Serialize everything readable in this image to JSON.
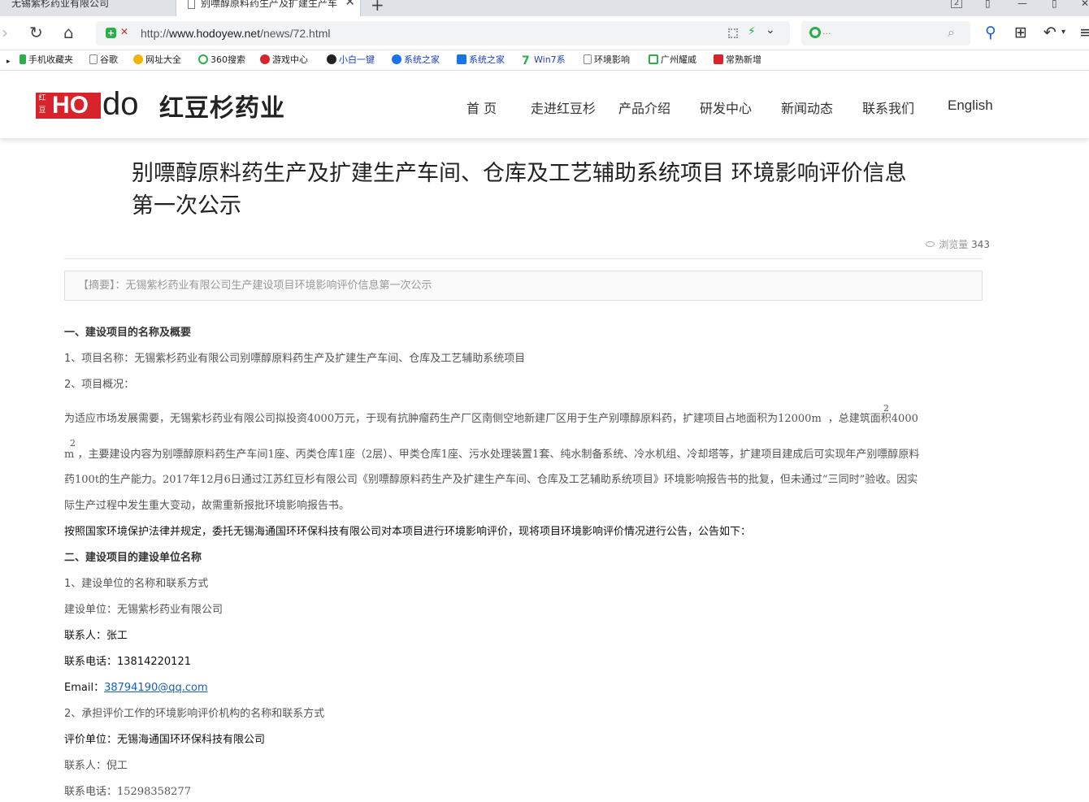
{
  "browser": {
    "tabs": [
      {
        "label": "无锡紫杉药业有限公司",
        "active": false
      },
      {
        "label": "别嘌醇原料药生产及扩建生产车",
        "active": true
      }
    ],
    "window_badge": "2",
    "url_prefix": "http://",
    "url_host": "www.hodoyew.net",
    "url_path": "/news/72.html",
    "search_hint": "...",
    "bookmarks": [
      "手机收藏夹",
      "谷歌",
      "网址大全",
      "360搜索",
      "游戏中心",
      "小白一键",
      "系统之家",
      "系统之家",
      "Win7系",
      "环境影响",
      "广州耀威",
      "常熟新增"
    ]
  },
  "site": {
    "logo_small": "红豆",
    "logo_ho": "HO",
    "logo_do": "do",
    "logo_cn": "红豆杉药业",
    "menu": [
      "首 页",
      "走进红豆杉",
      "产品介绍",
      "研发中心",
      "新闻动态",
      "联系我们",
      "English"
    ]
  },
  "article": {
    "title": " 别嘌醇原料药生产及扩建生产车间、仓库及工艺辅助系统项目 环境影响评价信息第一次公示",
    "views_label": "浏览量",
    "views_count": "343",
    "summary_label": "【摘要】：",
    "summary_text": "无锡紫杉药业有限公司生产建设项目环境影响评价信息第一次公示",
    "s1_heading": "一、建设项目的名称及概要",
    "s1_item1": "1、项目名称：无锡紫杉药业有限公司别嘌醇原料药生产及扩建生产车间、仓库及工艺辅助系统项目",
    "s1_item2": "2、项目概况：",
    "para1_line1": "为适应市场发展需要，无锡紫杉药业有限公司拟投资4000万元，于现有抗肿瘤药生产厂区南侧空地新建厂区用于生产别嘌醇原料药，扩建项目占地面积为12000m",
    "para1_line1_tail": "，总建筑面积4000",
    "sup_2": "2",
    "para1_line2": "m ，主要建设内容为别嘌醇原料药生产车间1座、丙类仓库1座（2层）、甲类仓库1座、污水处理装置1套、纯水制备系统、冷水机组、冷却塔等，扩建项目建成后可实现年产别嘌醇原料",
    "para1_line3": "药100t的生产能力。2017年12月6日通过江苏红豆杉有限公司《别嘌醇原料药生产及扩建生产车间、仓库及工艺辅助系统项目》环境影响报告书的批复，但未通过“三同时”验收。因实",
    "para1_line4": "际生产过程中发生重大变动，故需重新报批环境影响报告书。",
    "para2": "按照国家环境保护法律并规定，委托无锡海通国环环保科技有限公司对本项目进行环境影响评价，现将项目环境影响评价情况进行公告，公告如下：",
    "s2_heading": "二、建设项目的建设单位名称",
    "s2_item1": "1、建设单位的名称和联系方式",
    "builder": "建设单位：无锡紫杉药业有限公司",
    "contact1": "联系人：张工",
    "phone1": "联系电话：13814220121",
    "email_label": "Email：",
    "email": "38794190@qq.com",
    "s2_item2": "2、承担评价工作的环境影响评价机构的名称和联系方式",
    "evaluator": "评价单位：无锡海通国环环保科技有限公司",
    "contact2": "联系人：倪工",
    "phone2": "联系电话：15298358277"
  }
}
